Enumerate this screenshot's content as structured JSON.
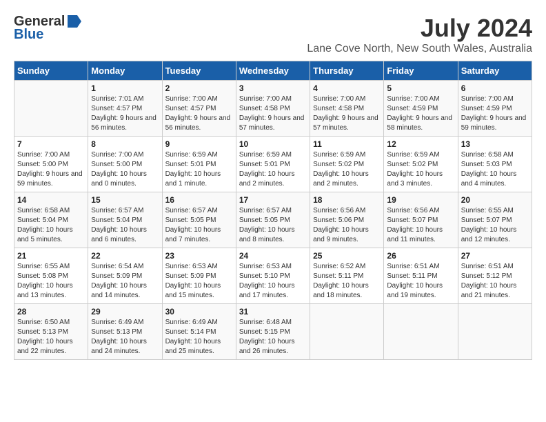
{
  "header": {
    "logo_general": "General",
    "logo_blue": "Blue",
    "month_year": "July 2024",
    "location": "Lane Cove North, New South Wales, Australia"
  },
  "days_of_week": [
    "Sunday",
    "Monday",
    "Tuesday",
    "Wednesday",
    "Thursday",
    "Friday",
    "Saturday"
  ],
  "weeks": [
    [
      {
        "day": "",
        "sunrise": "",
        "sunset": "",
        "daylight": ""
      },
      {
        "day": "1",
        "sunrise": "Sunrise: 7:01 AM",
        "sunset": "Sunset: 4:57 PM",
        "daylight": "Daylight: 9 hours and 56 minutes."
      },
      {
        "day": "2",
        "sunrise": "Sunrise: 7:00 AM",
        "sunset": "Sunset: 4:57 PM",
        "daylight": "Daylight: 9 hours and 56 minutes."
      },
      {
        "day": "3",
        "sunrise": "Sunrise: 7:00 AM",
        "sunset": "Sunset: 4:58 PM",
        "daylight": "Daylight: 9 hours and 57 minutes."
      },
      {
        "day": "4",
        "sunrise": "Sunrise: 7:00 AM",
        "sunset": "Sunset: 4:58 PM",
        "daylight": "Daylight: 9 hours and 57 minutes."
      },
      {
        "day": "5",
        "sunrise": "Sunrise: 7:00 AM",
        "sunset": "Sunset: 4:59 PM",
        "daylight": "Daylight: 9 hours and 58 minutes."
      },
      {
        "day": "6",
        "sunrise": "Sunrise: 7:00 AM",
        "sunset": "Sunset: 4:59 PM",
        "daylight": "Daylight: 9 hours and 59 minutes."
      }
    ],
    [
      {
        "day": "7",
        "sunrise": "Sunrise: 7:00 AM",
        "sunset": "Sunset: 5:00 PM",
        "daylight": "Daylight: 9 hours and 59 minutes."
      },
      {
        "day": "8",
        "sunrise": "Sunrise: 7:00 AM",
        "sunset": "Sunset: 5:00 PM",
        "daylight": "Daylight: 10 hours and 0 minutes."
      },
      {
        "day": "9",
        "sunrise": "Sunrise: 6:59 AM",
        "sunset": "Sunset: 5:01 PM",
        "daylight": "Daylight: 10 hours and 1 minute."
      },
      {
        "day": "10",
        "sunrise": "Sunrise: 6:59 AM",
        "sunset": "Sunset: 5:01 PM",
        "daylight": "Daylight: 10 hours and 2 minutes."
      },
      {
        "day": "11",
        "sunrise": "Sunrise: 6:59 AM",
        "sunset": "Sunset: 5:02 PM",
        "daylight": "Daylight: 10 hours and 2 minutes."
      },
      {
        "day": "12",
        "sunrise": "Sunrise: 6:59 AM",
        "sunset": "Sunset: 5:02 PM",
        "daylight": "Daylight: 10 hours and 3 minutes."
      },
      {
        "day": "13",
        "sunrise": "Sunrise: 6:58 AM",
        "sunset": "Sunset: 5:03 PM",
        "daylight": "Daylight: 10 hours and 4 minutes."
      }
    ],
    [
      {
        "day": "14",
        "sunrise": "Sunrise: 6:58 AM",
        "sunset": "Sunset: 5:04 PM",
        "daylight": "Daylight: 10 hours and 5 minutes."
      },
      {
        "day": "15",
        "sunrise": "Sunrise: 6:57 AM",
        "sunset": "Sunset: 5:04 PM",
        "daylight": "Daylight: 10 hours and 6 minutes."
      },
      {
        "day": "16",
        "sunrise": "Sunrise: 6:57 AM",
        "sunset": "Sunset: 5:05 PM",
        "daylight": "Daylight: 10 hours and 7 minutes."
      },
      {
        "day": "17",
        "sunrise": "Sunrise: 6:57 AM",
        "sunset": "Sunset: 5:05 PM",
        "daylight": "Daylight: 10 hours and 8 minutes."
      },
      {
        "day": "18",
        "sunrise": "Sunrise: 6:56 AM",
        "sunset": "Sunset: 5:06 PM",
        "daylight": "Daylight: 10 hours and 9 minutes."
      },
      {
        "day": "19",
        "sunrise": "Sunrise: 6:56 AM",
        "sunset": "Sunset: 5:07 PM",
        "daylight": "Daylight: 10 hours and 11 minutes."
      },
      {
        "day": "20",
        "sunrise": "Sunrise: 6:55 AM",
        "sunset": "Sunset: 5:07 PM",
        "daylight": "Daylight: 10 hours and 12 minutes."
      }
    ],
    [
      {
        "day": "21",
        "sunrise": "Sunrise: 6:55 AM",
        "sunset": "Sunset: 5:08 PM",
        "daylight": "Daylight: 10 hours and 13 minutes."
      },
      {
        "day": "22",
        "sunrise": "Sunrise: 6:54 AM",
        "sunset": "Sunset: 5:09 PM",
        "daylight": "Daylight: 10 hours and 14 minutes."
      },
      {
        "day": "23",
        "sunrise": "Sunrise: 6:53 AM",
        "sunset": "Sunset: 5:09 PM",
        "daylight": "Daylight: 10 hours and 15 minutes."
      },
      {
        "day": "24",
        "sunrise": "Sunrise: 6:53 AM",
        "sunset": "Sunset: 5:10 PM",
        "daylight": "Daylight: 10 hours and 17 minutes."
      },
      {
        "day": "25",
        "sunrise": "Sunrise: 6:52 AM",
        "sunset": "Sunset: 5:11 PM",
        "daylight": "Daylight: 10 hours and 18 minutes."
      },
      {
        "day": "26",
        "sunrise": "Sunrise: 6:51 AM",
        "sunset": "Sunset: 5:11 PM",
        "daylight": "Daylight: 10 hours and 19 minutes."
      },
      {
        "day": "27",
        "sunrise": "Sunrise: 6:51 AM",
        "sunset": "Sunset: 5:12 PM",
        "daylight": "Daylight: 10 hours and 21 minutes."
      }
    ],
    [
      {
        "day": "28",
        "sunrise": "Sunrise: 6:50 AM",
        "sunset": "Sunset: 5:13 PM",
        "daylight": "Daylight: 10 hours and 22 minutes."
      },
      {
        "day": "29",
        "sunrise": "Sunrise: 6:49 AM",
        "sunset": "Sunset: 5:13 PM",
        "daylight": "Daylight: 10 hours and 24 minutes."
      },
      {
        "day": "30",
        "sunrise": "Sunrise: 6:49 AM",
        "sunset": "Sunset: 5:14 PM",
        "daylight": "Daylight: 10 hours and 25 minutes."
      },
      {
        "day": "31",
        "sunrise": "Sunrise: 6:48 AM",
        "sunset": "Sunset: 5:15 PM",
        "daylight": "Daylight: 10 hours and 26 minutes."
      },
      {
        "day": "",
        "sunrise": "",
        "sunset": "",
        "daylight": ""
      },
      {
        "day": "",
        "sunrise": "",
        "sunset": "",
        "daylight": ""
      },
      {
        "day": "",
        "sunrise": "",
        "sunset": "",
        "daylight": ""
      }
    ]
  ]
}
